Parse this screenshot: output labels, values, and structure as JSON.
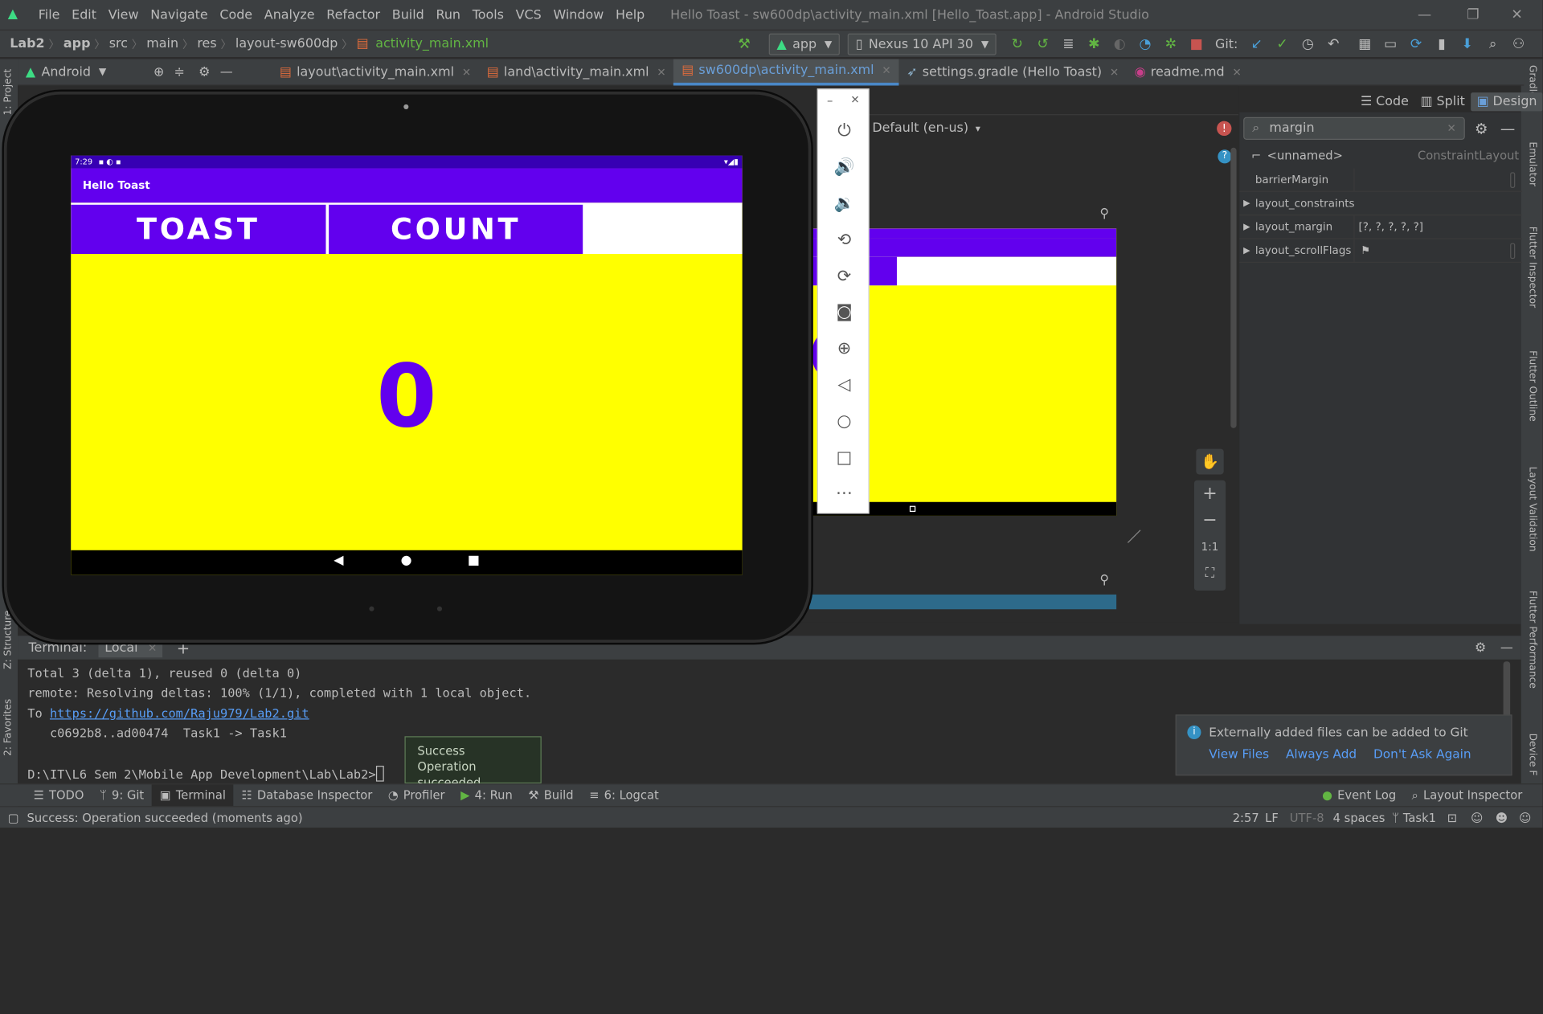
{
  "window": {
    "title": "Hello Toast - sw600dp\\activity_main.xml [Hello_Toast.app] - Android Studio",
    "controls": [
      "—",
      "❐",
      "✕"
    ]
  },
  "menu": [
    "File",
    "Edit",
    "View",
    "Navigate",
    "Code",
    "Analyze",
    "Refactor",
    "Build",
    "Run",
    "Tools",
    "VCS",
    "Window",
    "Help"
  ],
  "breadcrumb": [
    "Lab2",
    "app",
    "src",
    "main",
    "res",
    "layout-sw600dp",
    "activity_main.xml"
  ],
  "toolbar": {
    "config": "app",
    "device": "Nexus 10 API 30",
    "git_label": "Git:"
  },
  "project_view": "Android",
  "tabs": [
    {
      "label": "layout\\activity_main.xml"
    },
    {
      "label": "land\\activity_main.xml"
    },
    {
      "label": "sw600dp\\activity_main.xml"
    },
    {
      "label": "settings.gradle (Hello Toast)"
    },
    {
      "label": "readme.md"
    }
  ],
  "design": {
    "locale": "Default (en-us)",
    "view_modes": [
      "Code",
      "Split",
      "Design"
    ],
    "preview_count": "0"
  },
  "attributes": {
    "search_value": "margin",
    "component": "<unnamed>",
    "component_type": "ConstraintLayout",
    "rows": [
      {
        "name": "barrierMargin",
        "value": ""
      },
      {
        "name": "layout_constraints",
        "value": ""
      },
      {
        "name": "layout_margin",
        "value": "[?, ?, ?, ?, ?]"
      },
      {
        "name": "layout_scrollFlags",
        "value": "⚑"
      }
    ]
  },
  "emulator": {
    "status_time": "7:29",
    "app_title": "Hello Toast",
    "toast_button": "TOAST",
    "count_button": "COUNT",
    "count": "0"
  },
  "terminal": {
    "label": "Terminal:",
    "tab": "Local",
    "lines": [
      "Total 3 (delta 1), reused 0 (delta 0)",
      "remote: Resolving deltas: 100% (1/1), completed with 1 local object.",
      "To ",
      "   c0692b8..ad00474  Task1 -> Task1",
      "",
      "D:\\IT\\L6 Sem 2\\Mobile App Development\\Lab\\Lab2>"
    ],
    "repo_link": "https://github.com/Raju979/Lab2.git"
  },
  "toast_popup": {
    "title": "Success",
    "message": "Operation succeeded"
  },
  "notification": {
    "text": "Externally added files can be added to Git",
    "actions": [
      "View Files",
      "Always Add",
      "Don't Ask Again"
    ]
  },
  "tool_windows": [
    "TODO",
    "9: Git",
    "Terminal",
    "Database Inspector",
    "Profiler",
    "4: Run",
    "Build",
    "6: Logcat"
  ],
  "tool_windows_right": [
    "Event Log",
    "Layout Inspector"
  ],
  "status": {
    "message": "Success: Operation succeeded (moments ago)",
    "position": "2:57",
    "line_sep": "LF",
    "encoding": "UTF-8",
    "indent": "4 spaces",
    "branch": "Task1"
  },
  "side_panels": {
    "left": [
      "1: Project",
      "Z: Structure",
      "2: Favorites"
    ],
    "right": [
      "Gradle",
      "Emulator",
      "Flutter Inspector",
      "Flutter Outline",
      "Layout Validation",
      "Flutter Performance",
      "Device F"
    ]
  },
  "zoom": {
    "ratio": "1:1"
  },
  "colors": {
    "accent_purple": "#6200ee",
    "app_yellow": "#ffff00",
    "ide_bg": "#2b2b2b",
    "ide_panel": "#3c3f41",
    "link_blue": "#589df6"
  }
}
